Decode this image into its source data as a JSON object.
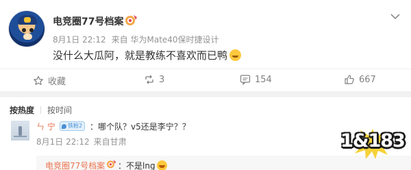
{
  "post": {
    "author": "电竞圈77号档案",
    "timestamp": "8月1日 22:12",
    "source": "来自 华为Mate40保时捷设计",
    "text": "没什么大瓜阿，就是教练不喜欢而已鸭",
    "text_emoji": "sleepy-face-emoji"
  },
  "actions": {
    "repost_label": "收藏",
    "repost_count": "",
    "comment_count": "3",
    "chat_count": "154",
    "like_count": "667"
  },
  "comments_sort": {
    "hot_label": "按热度",
    "time_label": "按时间"
  },
  "comment": {
    "author": "ㄣ 宁",
    "badge": "铁粉2",
    "text": "：哪个队？v5还是李宁？？",
    "timestamp": "8月1日 22:12",
    "source": "来自甘肃"
  },
  "reply": {
    "author": "电竞圈77号档案",
    "text": "：不是lng",
    "emoji": "grin-emoji"
  },
  "watermark": {
    "text": "1&183"
  },
  "colors": {
    "link": "#eb7350",
    "meta": "#939393",
    "badge": "#4a8fd4",
    "band": "#f2f2f2"
  }
}
